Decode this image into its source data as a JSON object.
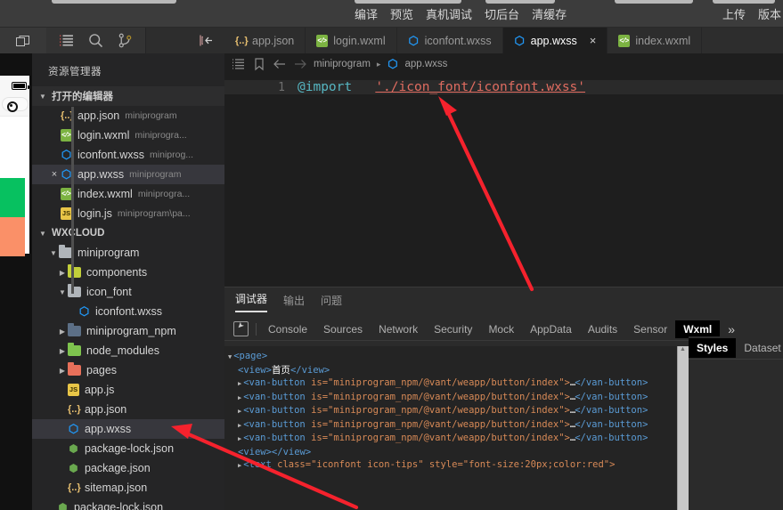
{
  "topbar": {
    "left_menu": [
      "编译",
      "预览",
      "真机调试",
      "切后台",
      "清缓存"
    ],
    "right_menu": [
      "上传",
      "版本"
    ]
  },
  "tabs": [
    {
      "label": "app.json",
      "icon": "json-file-icon",
      "kind": "json",
      "active": false,
      "closable": false
    },
    {
      "label": "login.wxml",
      "icon": "wxml-file-icon",
      "kind": "wxml",
      "active": false,
      "closable": false
    },
    {
      "label": "iconfont.wxss",
      "icon": "wxss-file-icon",
      "kind": "wxss",
      "active": false,
      "closable": false
    },
    {
      "label": "app.wxss",
      "icon": "wxss-file-icon",
      "kind": "wxss",
      "active": true,
      "closable": true,
      "close_label": "×"
    },
    {
      "label": "index.wxml",
      "icon": "wxml-file-icon",
      "kind": "wxml",
      "active": false,
      "closable": false
    }
  ],
  "activity_bar": {
    "icons": [
      "explorer-icon",
      "search-icon",
      "source-control-icon"
    ],
    "collapse_icon": "collapse-sidebar-icon",
    "window_icon": "split-window-icon"
  },
  "sidebar": {
    "title": "资源管理器",
    "open_editors": {
      "label": "打开的编辑器",
      "items": [
        {
          "name": "app.json",
          "meta": "miniprogram",
          "kind": "json",
          "selected": false,
          "close": ""
        },
        {
          "name": "login.wxml",
          "meta": "miniprogra...",
          "kind": "wxml",
          "selected": false,
          "close": ""
        },
        {
          "name": "iconfont.wxss",
          "meta": "miniprog...",
          "kind": "wxss",
          "selected": false,
          "close": ""
        },
        {
          "name": "app.wxss",
          "meta": "miniprogram",
          "kind": "wxss",
          "selected": true,
          "close": "×"
        },
        {
          "name": "index.wxml",
          "meta": "miniprogra...",
          "kind": "wxml",
          "selected": false,
          "close": ""
        },
        {
          "name": "login.js",
          "meta": "miniprogram\\pa...",
          "kind": "js",
          "selected": false,
          "close": ""
        }
      ]
    },
    "project": {
      "label": "WXCLOUD",
      "tree": [
        {
          "name": "miniprogram",
          "type": "folder",
          "indent": 1,
          "expanded": true,
          "color": "#b0b5ba"
        },
        {
          "name": "components",
          "type": "folder",
          "indent": 2,
          "expanded": false,
          "color": "#c2cf3a"
        },
        {
          "name": "icon_font",
          "type": "folder",
          "indent": 2,
          "expanded": true,
          "color": "#b0b5ba"
        },
        {
          "name": "iconfont.wxss",
          "type": "file",
          "kind": "wxss",
          "indent": 3
        },
        {
          "name": "miniprogram_npm",
          "type": "folder",
          "indent": 2,
          "expanded": false,
          "color": "#5c6f86"
        },
        {
          "name": "node_modules",
          "type": "folder",
          "indent": 2,
          "expanded": false,
          "color": "#7ec44e"
        },
        {
          "name": "pages",
          "type": "folder",
          "indent": 2,
          "expanded": false,
          "color": "#e8705a"
        },
        {
          "name": "app.js",
          "type": "file",
          "kind": "js",
          "indent": 3
        },
        {
          "name": "app.json",
          "type": "file",
          "kind": "json",
          "indent": 3
        },
        {
          "name": "app.wxss",
          "type": "file",
          "kind": "wxss",
          "indent": 3,
          "selected": true
        },
        {
          "name": "package-lock.json",
          "type": "file",
          "kind": "node",
          "indent": 3
        },
        {
          "name": "package.json",
          "type": "file",
          "kind": "node",
          "indent": 3
        },
        {
          "name": "sitemap.json",
          "type": "file",
          "kind": "json",
          "indent": 3
        },
        {
          "name": "package-lock.json",
          "type": "file",
          "kind": "node",
          "indent": 2
        }
      ]
    }
  },
  "editor": {
    "breadcrumb": {
      "list_icon": "outline-icon",
      "bookmark_icon": "bookmark-icon",
      "back_icon": "back-arrow-icon",
      "forward_icon": "forward-arrow-icon",
      "path_root": "miniprogram",
      "separator": "▸",
      "file_icon": "wxss-file-icon",
      "file": "app.wxss"
    },
    "line_number": "1",
    "code": {
      "keyword": "@import",
      "string": "'./icon_font/iconfont.wxss'"
    }
  },
  "devtools": {
    "tabs": [
      {
        "label": "调试器",
        "active": true
      },
      {
        "label": "输出",
        "active": false
      },
      {
        "label": "问题",
        "active": false
      }
    ],
    "inspect_icon": "inspect-element-icon",
    "panels": [
      {
        "label": "Console",
        "active": false
      },
      {
        "label": "Sources",
        "active": false
      },
      {
        "label": "Network",
        "active": false
      },
      {
        "label": "Security",
        "active": false
      },
      {
        "label": "Mock",
        "active": false
      },
      {
        "label": "AppData",
        "active": false
      },
      {
        "label": "Audits",
        "active": false
      },
      {
        "label": "Sensor",
        "active": false
      },
      {
        "label": "Wxml",
        "active": true
      }
    ],
    "more_panels": "»",
    "styles_tabs": [
      {
        "label": "Styles",
        "active": true
      },
      {
        "label": "Dataset",
        "active": false
      }
    ],
    "dom_tree": [
      {
        "arrow": "▾",
        "indent": 0,
        "parts": [
          {
            "t": "tag",
            "v": "<page>"
          }
        ]
      },
      {
        "arrow": "",
        "indent": 1,
        "parts": [
          {
            "t": "tag",
            "v": "<view>"
          },
          {
            "t": "text",
            "v": "首页"
          },
          {
            "t": "tag",
            "v": "</view>"
          }
        ]
      },
      {
        "arrow": "▸",
        "indent": 1,
        "parts": [
          {
            "t": "tag",
            "v": "<van-button"
          },
          {
            "t": "attr",
            "v": " is=\"miniprogram_npm/@vant/weapp/button/index\">"
          },
          {
            "t": "ellipsis",
            "v": "…"
          },
          {
            "t": "tag",
            "v": "</van-button>"
          }
        ]
      },
      {
        "arrow": "▸",
        "indent": 1,
        "parts": [
          {
            "t": "tag",
            "v": "<van-button"
          },
          {
            "t": "attr",
            "v": " is=\"miniprogram_npm/@vant/weapp/button/index\">"
          },
          {
            "t": "ellipsis",
            "v": "…"
          },
          {
            "t": "tag",
            "v": "</van-button>"
          }
        ]
      },
      {
        "arrow": "▸",
        "indent": 1,
        "parts": [
          {
            "t": "tag",
            "v": "<van-button"
          },
          {
            "t": "attr",
            "v": " is=\"miniprogram_npm/@vant/weapp/button/index\">"
          },
          {
            "t": "ellipsis",
            "v": "…"
          },
          {
            "t": "tag",
            "v": "</van-button>"
          }
        ]
      },
      {
        "arrow": "▸",
        "indent": 1,
        "parts": [
          {
            "t": "tag",
            "v": "<van-button"
          },
          {
            "t": "attr",
            "v": " is=\"miniprogram_npm/@vant/weapp/button/index\">"
          },
          {
            "t": "ellipsis",
            "v": "…"
          },
          {
            "t": "tag",
            "v": "</van-button>"
          }
        ]
      },
      {
        "arrow": "▸",
        "indent": 1,
        "parts": [
          {
            "t": "tag",
            "v": "<van-button"
          },
          {
            "t": "attr",
            "v": " is=\"miniprogram_npm/@vant/weapp/button/index\">"
          },
          {
            "t": "ellipsis",
            "v": "…"
          },
          {
            "t": "tag",
            "v": "</van-button>"
          }
        ]
      },
      {
        "arrow": "",
        "indent": 1,
        "parts": [
          {
            "t": "tag",
            "v": "<view></view>"
          }
        ]
      },
      {
        "arrow": "▸",
        "indent": 1,
        "parts": [
          {
            "t": "tag",
            "v": "<text"
          },
          {
            "t": "attr",
            "v": " class=\"iconfont icon-tips\" style=\"font-size:20px;color:red\">"
          }
        ]
      }
    ]
  },
  "simulator": {
    "battery_icon": "battery-icon",
    "capsule_icon": "capsule-menu-icon",
    "green_button_color": "#07c160",
    "orange_button_color": "#fa9068"
  },
  "annotations": {
    "arrow_color": "#f5222d",
    "arrows": [
      "arrow-to-import-string",
      "arrow-to-app-wxss-file"
    ]
  }
}
